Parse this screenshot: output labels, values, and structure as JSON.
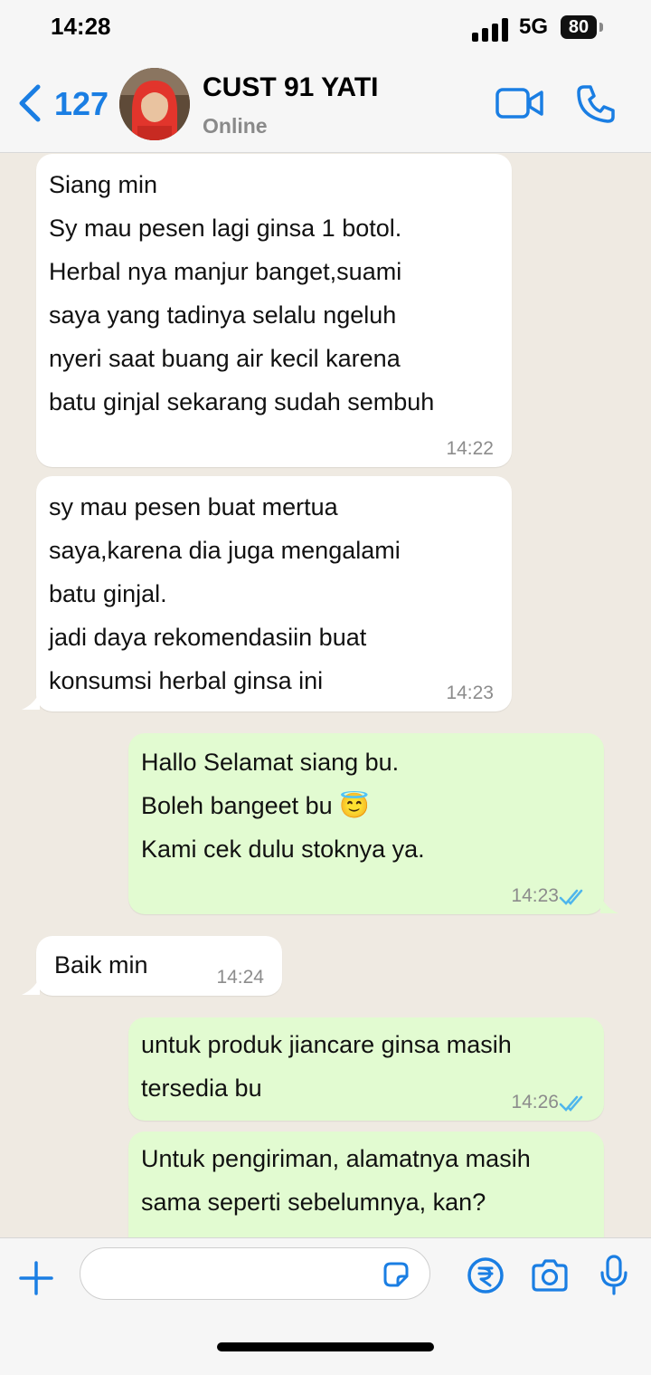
{
  "status_bar": {
    "time": "14:28",
    "network": "5G",
    "battery": "80"
  },
  "header": {
    "back_count": "127",
    "contact_name": "CUST 91 YATI",
    "contact_status": "Online"
  },
  "messages": [
    {
      "direction": "in",
      "text": "Siang min\nSy mau pesen lagi ginsa 1 botol.\nHerbal nya manjur banget,suami\nsaya yang tadinya selalu ngeluh\nnyeri saat buang air kecil karena\nbatu ginjal sekarang sudah sembuh",
      "time": "14:22"
    },
    {
      "direction": "in",
      "text": "sy mau pesen buat mertua\nsaya,karena dia juga mengalami\nbatu ginjal.\njadi daya rekomendasiin buat\nkonsumsi herbal ginsa ini",
      "time": "14:23"
    },
    {
      "direction": "out",
      "text": "Hallo Selamat siang bu.\nBoleh bangeet bu 😇\nKami cek dulu stoknya ya.",
      "time": "14:23",
      "status": "read"
    },
    {
      "direction": "in",
      "text": "Baik min",
      "time": "14:24"
    },
    {
      "direction": "out",
      "text": "untuk produk jiancare ginsa masih\ntersedia bu",
      "time": "14:26",
      "status": "read"
    },
    {
      "direction": "out",
      "text": "Untuk pengiriman, alamatnya masih\nsama seperti sebelumnya, kan?",
      "time": "",
      "status": ""
    }
  ],
  "input": {
    "placeholder": "",
    "value": ""
  },
  "colors": {
    "accent": "#1a7ee3",
    "incoming_bubble": "#ffffff",
    "outgoing_bubble": "#e2fbd1",
    "chat_background": "#efeae2",
    "read_ticks": "#4fb6ec"
  },
  "icons": [
    "back-chevron-icon",
    "video-call-icon",
    "phone-call-icon",
    "plus-icon",
    "sticker-icon",
    "rupee-payment-icon",
    "camera-icon",
    "microphone-icon"
  ]
}
